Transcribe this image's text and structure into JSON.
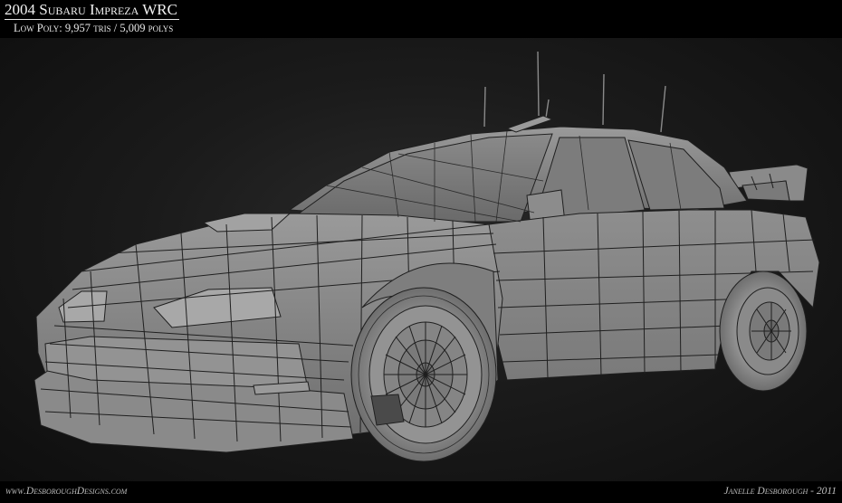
{
  "header": {
    "title": "2004 Subaru Impreza WRC",
    "subtitle": "Low Poly: 9,957 tris / 5,009 polys"
  },
  "footer": {
    "website": "www.DesboroughDesigns.com",
    "credit": "Janelle Desborough - 2011"
  },
  "render": {
    "subject": "car-wireframe-render",
    "background_color": "#1b1b1b",
    "model_color": "#8c8c8c",
    "wire_color": "#1f1f1f"
  }
}
